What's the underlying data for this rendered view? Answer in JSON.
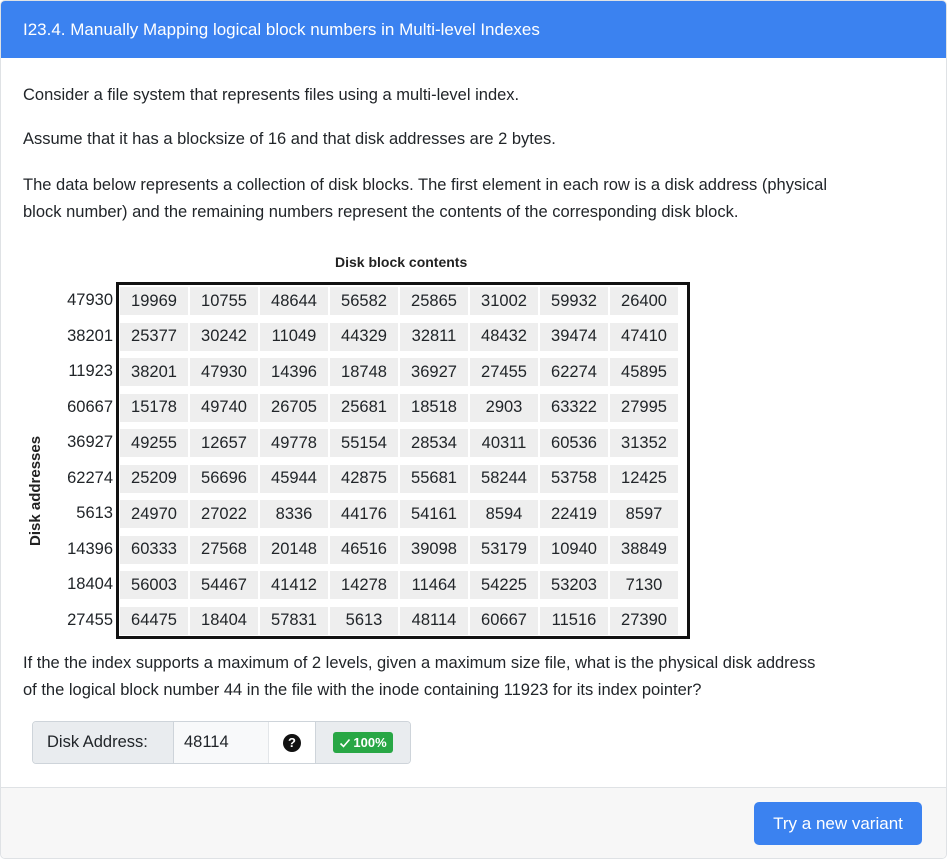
{
  "header": {
    "title": "I23.4. Manually Mapping logical block numbers in Multi-level Indexes"
  },
  "question": {
    "line1": "Consider a file system that represents files using a multi-level index.",
    "line2": "Assume that it has a blocksize of 16 and that disk addresses are 2 bytes.",
    "line3a": "The data below represents a collection of disk blocks. The first element in each row is a disk address (physical",
    "line3b": "block number) and the remaining numbers represent the contents of the corresponding disk block.",
    "prompt_a": "If the the index supports a maximum of 2 levels, given a maximum size file, what is the physical disk address",
    "prompt_b": "of the logical block number 44 in the file with the inode containing 11923 for its index pointer?"
  },
  "table": {
    "column_header": "Disk block contents",
    "row_header": "Disk addresses",
    "rows": [
      {
        "address": "47930",
        "cells": [
          "19969",
          "10755",
          "48644",
          "56582",
          "25865",
          "31002",
          "59932",
          "26400"
        ]
      },
      {
        "address": "38201",
        "cells": [
          "25377",
          "30242",
          "11049",
          "44329",
          "32811",
          "48432",
          "39474",
          "47410"
        ]
      },
      {
        "address": "11923",
        "cells": [
          "38201",
          "47930",
          "14396",
          "18748",
          "36927",
          "27455",
          "62274",
          "45895"
        ]
      },
      {
        "address": "60667",
        "cells": [
          "15178",
          "49740",
          "26705",
          "25681",
          "18518",
          "2903",
          "63322",
          "27995"
        ]
      },
      {
        "address": "36927",
        "cells": [
          "49255",
          "12657",
          "49778",
          "55154",
          "28534",
          "40311",
          "60536",
          "31352"
        ]
      },
      {
        "address": "62274",
        "cells": [
          "25209",
          "56696",
          "45944",
          "42875",
          "55681",
          "58244",
          "53758",
          "12425"
        ]
      },
      {
        "address": "5613",
        "cells": [
          "24970",
          "27022",
          "8336",
          "44176",
          "54161",
          "8594",
          "22419",
          "8597"
        ]
      },
      {
        "address": "14396",
        "cells": [
          "60333",
          "27568",
          "20148",
          "46516",
          "39098",
          "53179",
          "10940",
          "38849"
        ]
      },
      {
        "address": "18404",
        "cells": [
          "56003",
          "54467",
          "41412",
          "14278",
          "11464",
          "54225",
          "53203",
          "7130"
        ]
      },
      {
        "address": "27455",
        "cells": [
          "64475",
          "18404",
          "57831",
          "5613",
          "48114",
          "60667",
          "11516",
          "27390"
        ]
      }
    ]
  },
  "answer": {
    "label": "Disk Address:",
    "value": "48114",
    "help_icon": "question-circle-icon",
    "score": "100%",
    "score_icon": "check-icon"
  },
  "footer": {
    "button_label": "Try a new variant"
  },
  "colors": {
    "primary": "#3b82f0",
    "success": "#28a745"
  }
}
